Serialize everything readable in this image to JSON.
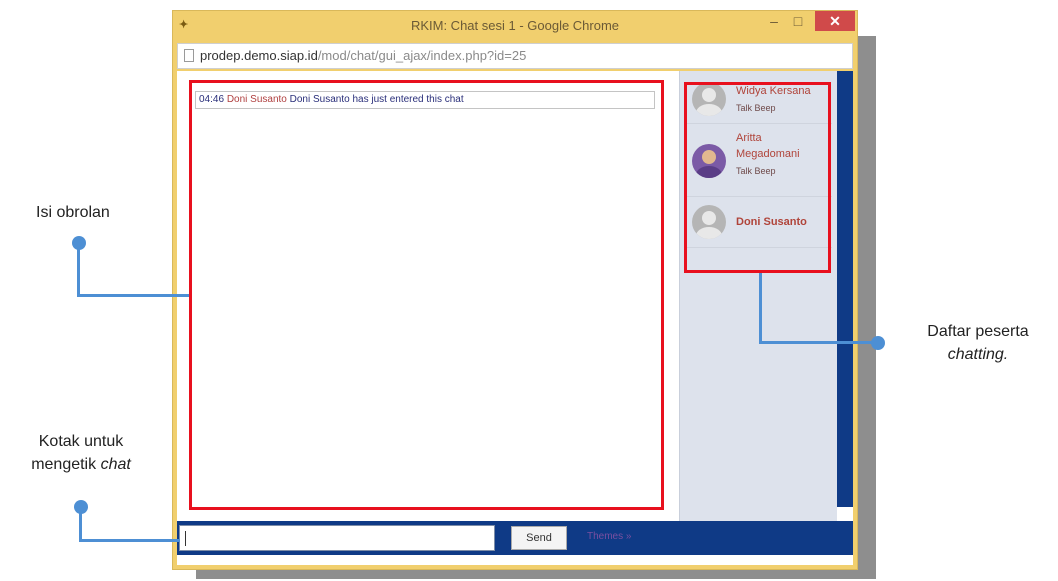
{
  "window": {
    "title": "RKIM: Chat sesi 1 - Google Chrome",
    "url_host": "prodep.demo.siap.id",
    "url_path": "/mod/chat/gui_ajax/index.php?id=25",
    "minimize_glyph": "–",
    "maximize_glyph": "□",
    "close_glyph": "✕"
  },
  "chat": {
    "messages": [
      {
        "time": "04:46",
        "sender": "Doni Susanto",
        "text": "Doni Susanto has just entered this chat"
      }
    ]
  },
  "participants": [
    {
      "name": "Widya Kersana",
      "action": "Talk Beep",
      "avatar": "default-avatar-icon"
    },
    {
      "name_line1": "Aritta",
      "name_line2": "Megadomani",
      "action": "Talk Beep",
      "avatar": "user-photo"
    },
    {
      "name": "Doni Susanto",
      "avatar": "default-avatar-icon"
    }
  ],
  "composer": {
    "input_value": "",
    "send_label": "Send",
    "themes_label": "Themes »"
  },
  "annotations": {
    "content": "Isi obrolan",
    "participants_line1": "Daftar peserta",
    "participants_line2": "chatting.",
    "input_line1": "Kotak untuk",
    "input_line2_prefix": "mengetik ",
    "input_line2_em": "chat"
  },
  "colors": {
    "highlight": "#e8101e",
    "callout": "#4d8fd4",
    "theme_bar": "#0f3a86",
    "titlebar": "#f1cf6e"
  }
}
